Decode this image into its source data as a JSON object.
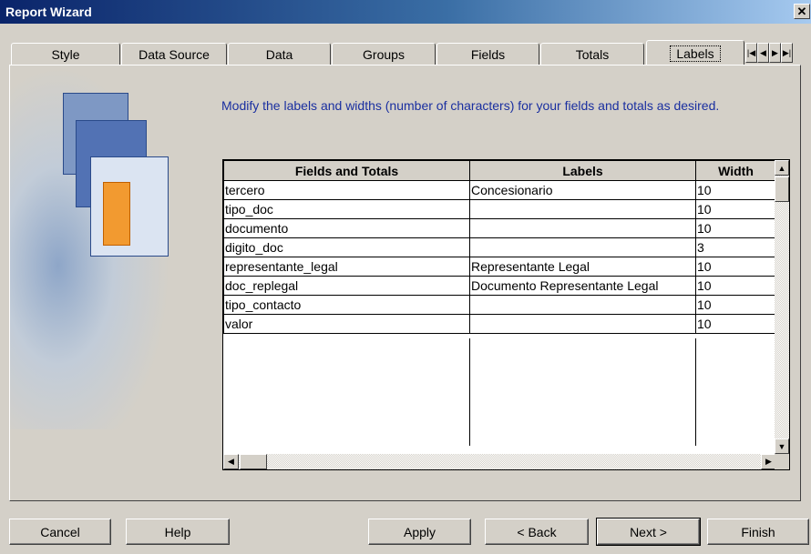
{
  "window": {
    "title": "Report Wizard",
    "close_glyph": "✕"
  },
  "tabs": [
    {
      "label": "Style"
    },
    {
      "label": "Data Source"
    },
    {
      "label": "Data"
    },
    {
      "label": "Groups"
    },
    {
      "label": "Fields"
    },
    {
      "label": "Totals"
    },
    {
      "label": "Labels",
      "active": true
    }
  ],
  "tab_scroller": {
    "icons": [
      "first-icon",
      "prev-icon",
      "next-icon",
      "last-icon"
    ]
  },
  "instruction": "Modify the labels and widths (number of characters) for your fields and totals as desired.",
  "grid": {
    "headers": [
      "Fields and Totals",
      "Labels",
      "Width"
    ],
    "rows": [
      {
        "field": "tercero",
        "label": "Concesionario",
        "width": "10"
      },
      {
        "field": "tipo_doc",
        "label": "",
        "width": "10"
      },
      {
        "field": "documento",
        "label": "",
        "width": "10"
      },
      {
        "field": "digito_doc",
        "label": "",
        "width": "3"
      },
      {
        "field": "representante_legal",
        "label": "Representante Legal",
        "width": "10"
      },
      {
        "field": "doc_replegal",
        "label": "Documento Representante Legal",
        "width": "10"
      },
      {
        "field": "tipo_contacto",
        "label": "",
        "width": "10"
      },
      {
        "field": "valor",
        "label": "",
        "width": "10"
      }
    ]
  },
  "buttons": {
    "cancel": "Cancel",
    "help": "Help",
    "apply": "Apply",
    "back": "< Back",
    "next": "Next >",
    "finish": "Finish"
  },
  "colors": {
    "title_gradient_start": "#0a246a",
    "instruction_text": "#1a2fa0",
    "face": "#d4d0c8"
  }
}
